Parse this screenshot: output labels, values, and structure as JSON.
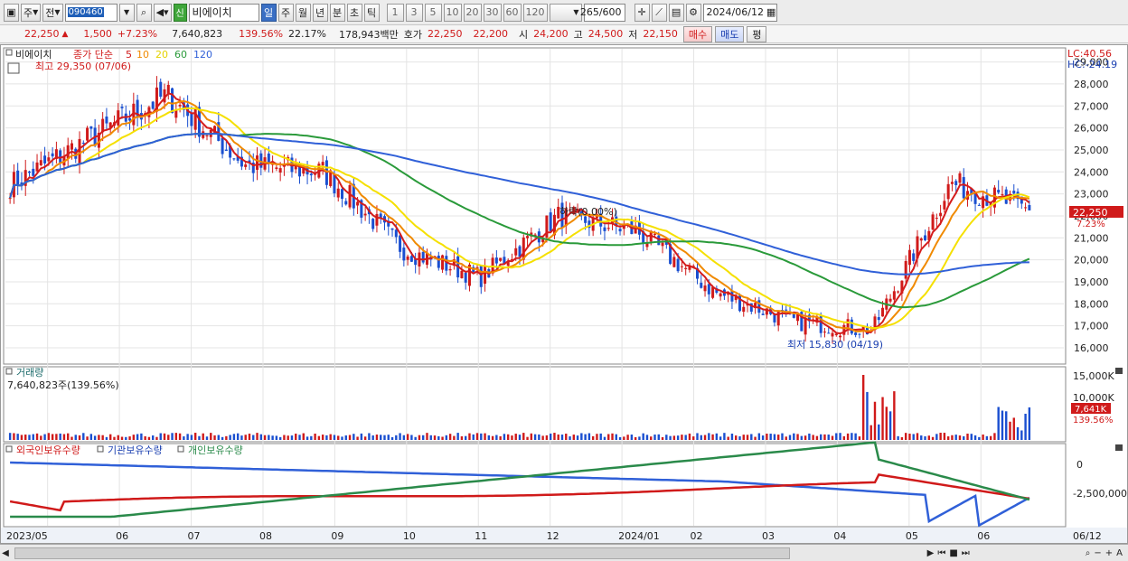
{
  "toolbar": {
    "mode1": "주",
    "mode2": "전",
    "code": "090460",
    "name": "비에이치",
    "shin": "신",
    "periods": [
      "일",
      "주",
      "월",
      "년",
      "분",
      "초",
      "틱"
    ],
    "counts": [
      "1",
      "3",
      "5",
      "10",
      "20",
      "30",
      "60",
      "120"
    ],
    "view_count": "265",
    "view_total": "/600",
    "date": "2024/06/12"
  },
  "quote": {
    "price": "22,250",
    "change": "1,500",
    "change_rate": "+7.23%",
    "volume": "7,640,823",
    "vol_ratio": "139.56%",
    "turnover": "22.17%",
    "amount": "178,943백만",
    "hoga_label": "호가",
    "ask": "22,250",
    "bid": "22,200",
    "open_label": "시",
    "open": "24,200",
    "high_label": "고",
    "high": "24,500",
    "low_label": "저",
    "low": "22,150",
    "buy_label": "매수",
    "sell_label": "매도",
    "eval_label": "평"
  },
  "legend": {
    "name": "비에이치",
    "price_type": "종가 단순",
    "ma5": "5",
    "ma10": "10",
    "ma20": "20",
    "ma60": "60",
    "ma120": "120",
    "max_label": "최고 29,350 (07/06)",
    "min_label": "최저 15,830 (04/19)",
    "rate_label": "하락(0.00%)",
    "lc": "LC:40.56",
    "hc": "HC:-24.19"
  },
  "colors": {
    "ma5": "#d41c1c",
    "ma10": "#f08a00",
    "ma20": "#f5e000",
    "ma60": "#2a9a3a",
    "ma120": "#3060d8",
    "up": "#d01a1a",
    "down": "#1a4fd0"
  },
  "price_axis": [
    "29,000",
    "28,000",
    "27,000",
    "26,000",
    "25,000",
    "24,000",
    "23,000",
    "22,000",
    "21,000",
    "20,000",
    "19,000",
    "18,000",
    "17,000",
    "16,000"
  ],
  "current_price_tag": "22,250",
  "current_rate_tag": "7.23%",
  "volume_panel": {
    "title": "거래량",
    "info": "7,640,823주(139.56%)",
    "axis": [
      "15,000K",
      "10,000K"
    ],
    "tag": "7,641K",
    "tag_rate": "139.56%"
  },
  "holding_panel": {
    "series": [
      "외국인보유수량",
      "기관보유수량",
      "개인보유수량"
    ],
    "axis": [
      "0",
      "-2,500,000"
    ]
  },
  "x_axis": [
    "2023/05",
    "06",
    "07",
    "08",
    "09",
    "10",
    "11",
    "12",
    "2024/01",
    "02",
    "03",
    "04",
    "05",
    "06",
    "06/12"
  ],
  "chart_data": {
    "type": "candlestick",
    "title": "비에이치",
    "ylabel": "",
    "ylim": [
      15300,
      29600
    ],
    "months": [
      "2023/05",
      "06",
      "07",
      "08",
      "09",
      "10",
      "11",
      "12",
      "2024/01",
      "02",
      "03",
      "04",
      "05",
      "06"
    ],
    "close_approx": [
      {
        "x": "2023/05",
        "y": 23400
      },
      {
        "x": "06",
        "y": 25500
      },
      {
        "x": "07",
        "y": 27500
      },
      {
        "x": "08",
        "y": 24300
      },
      {
        "x": "09",
        "y": 24000
      },
      {
        "x": "10",
        "y": 20500
      },
      {
        "x": "11",
        "y": 19200
      },
      {
        "x": "12",
        "y": 22000
      },
      {
        "x": "2024/01",
        "y": 21300
      },
      {
        "x": "02",
        "y": 18500
      },
      {
        "x": "03",
        "y": 17200
      },
      {
        "x": "04",
        "y": 16800
      },
      {
        "x": "05",
        "y": 23500
      },
      {
        "x": "06",
        "y": 22250
      }
    ],
    "high": {
      "value": 29350,
      "date": "07/06"
    },
    "low": {
      "value": 15830,
      "date": "04/19"
    },
    "last_close": 22250
  }
}
